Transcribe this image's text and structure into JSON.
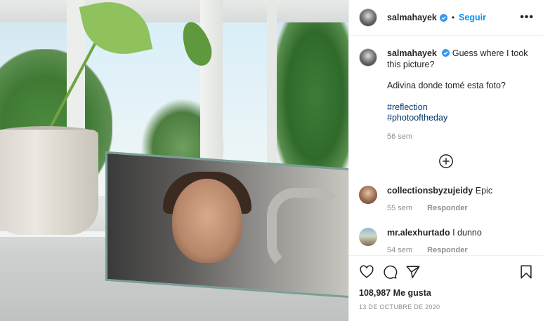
{
  "header": {
    "username": "salmahayek",
    "separator": "•",
    "follow_label": "Seguir",
    "more_label": "•••"
  },
  "caption": {
    "username": "salmahayek",
    "line1": "Guess where I took this picture?",
    "line2": "Adivina donde tomé esta foto?",
    "hashtags": [
      "#reflection",
      "#photooftheday"
    ],
    "age": "56 sem"
  },
  "comments": [
    {
      "username": "collectionsbyzujeidy",
      "text": "Epic",
      "age": "55 sem",
      "reply_label": "Responder"
    },
    {
      "username": "mr.alexhurtado",
      "text": "I dunno",
      "age": "54 sem",
      "reply_label": "Responder"
    }
  ],
  "footer": {
    "likes": "108,987 Me gusta",
    "date": "13 DE OCTUBRE DE 2020"
  },
  "icons": {
    "verified": "verified-badge-icon",
    "like": "heart-icon",
    "comment": "comment-bubble-icon",
    "share": "paper-plane-icon",
    "save": "bookmark-icon",
    "load_more": "plus-circle-icon"
  },
  "colors": {
    "accent": "#0095f6",
    "hashtag": "#00376b",
    "muted": "#8e8e8e"
  }
}
